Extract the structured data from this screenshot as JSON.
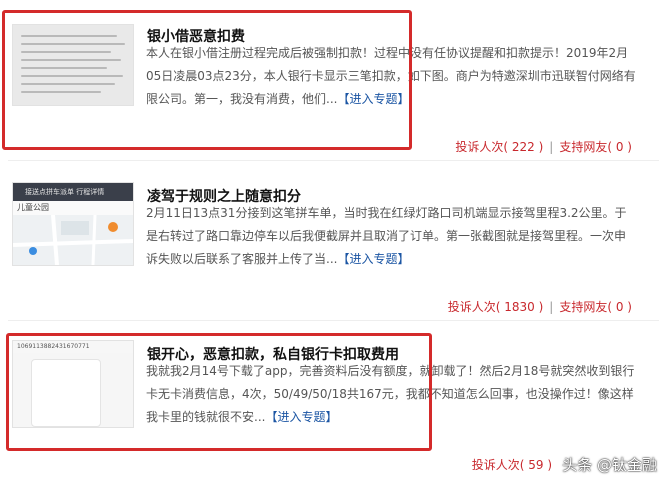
{
  "items": [
    {
      "title": "银小借恶意扣费",
      "desc": "本人在银小借注册过程完成后被强制扣款！过程中没有任协议提醒和扣款提示！2019年2月05日凌晨03点23分，本人银行卡显示三笔扣款，如下图。商户为特邀深圳市迅联智付网络有限公司。第一，我没有消费，他们...",
      "more": "【进入专题】",
      "complaint_label": "投诉人次",
      "complaint_count": "( 222 )",
      "support_label": "支持网友",
      "support_count": "( 0 )"
    },
    {
      "title": "凌驾于规则之上随意扣分",
      "desc": "2月11日13点31分接到这笔拼车单，当时我在红绿灯路口司机端显示接驾里程3.2公里。于是右转过了路口靠边停车以后我便截屏并且取消了订单。第一张截图就是接驾里程。一次申诉失败以后联系了客服并上传了当...",
      "more": "【进入专题】",
      "complaint_label": "投诉人次",
      "complaint_count": "( 1830 )",
      "support_label": "支持网友",
      "support_count": "( 0 )",
      "thumb_header": "接送点拼车派单    行程详情",
      "thumb_place": "儿童公园"
    },
    {
      "title": "银开心，恶意扣款，私自银行卡扣取费用",
      "desc": "我就我2月14号下载了app，完善资料后没有额度，就卸载了！然后2月18号就突然收到银行卡无卡消费信息，4次，50/49/50/18共167元，我都不知道怎么回事，也没操作过！像这样我卡里的钱就很不安...",
      "more": "【进入专题】",
      "complaint_label": "投诉人次",
      "complaint_count": "( 59 )",
      "thumb_sms_number": "1069113882431670771"
    }
  ],
  "watermark": "头条 @钛金融",
  "colors": {
    "highlight_box": "#d42a2a",
    "meta_red": "#c8282d",
    "link_blue": "#1b55a3"
  }
}
